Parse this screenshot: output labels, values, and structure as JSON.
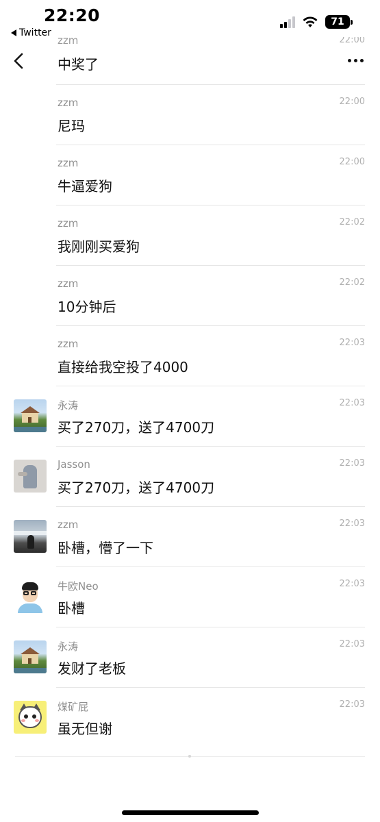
{
  "status_bar": {
    "time": "22:20",
    "back_app": "Twitter",
    "battery": "71"
  },
  "header": {
    "back_icon": "chevron-left-icon",
    "more_icon": "more-dots-icon"
  },
  "top_message": {
    "name": "zzm",
    "time": "22:00",
    "text": "中奖了"
  },
  "messages": [
    {
      "name": "zzm",
      "time": "22:00",
      "text": "尼玛",
      "avatar": "none"
    },
    {
      "name": "zzm",
      "time": "22:00",
      "text": "牛逼爱狗",
      "avatar": "none"
    },
    {
      "name": "zzm",
      "time": "22:02",
      "text": "我刚刚买爱狗",
      "avatar": "none"
    },
    {
      "name": "zzm",
      "time": "22:02",
      "text": "10分钟后",
      "avatar": "none"
    },
    {
      "name": "zzm",
      "time": "22:03",
      "text": "直接给我空投了4000",
      "avatar": "none"
    },
    {
      "name": "永涛",
      "time": "22:03",
      "text": "买了270刀，送了4700刀",
      "avatar": "house-photo"
    },
    {
      "name": "Jasson",
      "time": "22:03",
      "text": "买了270刀，送了4700刀",
      "avatar": "person-photo"
    },
    {
      "name": "zzm",
      "time": "22:03",
      "text": "卧槽，懵了一下",
      "avatar": "snow-photo"
    },
    {
      "name": "牛欧Neo",
      "time": "22:03",
      "text": "卧槽",
      "avatar": "cartoon-man"
    },
    {
      "name": "永涛",
      "time": "22:03",
      "text": "发财了老板",
      "avatar": "house-photo"
    },
    {
      "name": "煤矿屁",
      "time": "22:03",
      "text": "虽无但谢",
      "avatar": "cartoon-cat"
    }
  ]
}
